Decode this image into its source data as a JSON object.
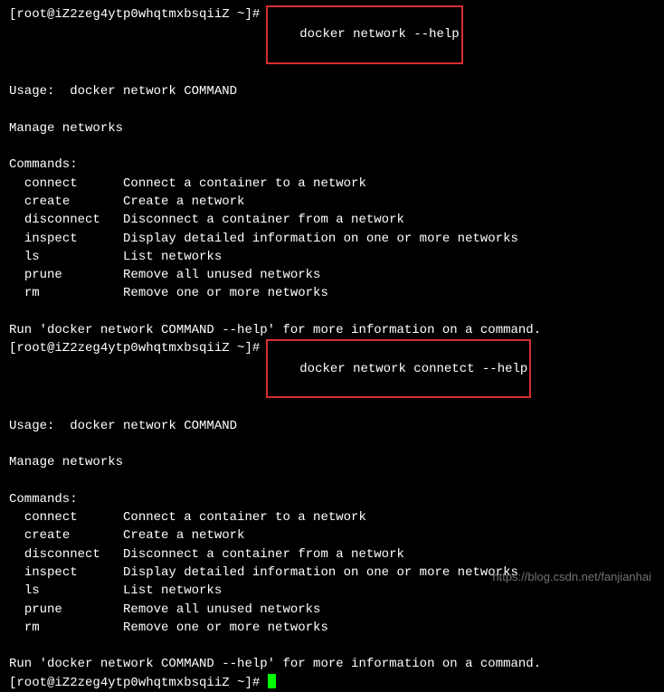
{
  "prompt": "[root@iZ2zeg4ytp0whqtmxbsqiiZ ~]# ",
  "cmd1": "docker network --help",
  "cmd2": "docker network connetct --help",
  "outputs": {
    "usage": "Usage:  docker network COMMAND",
    "manage": "Manage networks",
    "commands_header": "Commands:",
    "commands": [
      {
        "name": "connect",
        "desc": "Connect a container to a network"
      },
      {
        "name": "create",
        "desc": "Create a network"
      },
      {
        "name": "disconnect",
        "desc": "Disconnect a container from a network"
      },
      {
        "name": "inspect",
        "desc": "Display detailed information on one or more networks"
      },
      {
        "name": "ls",
        "desc": "List networks"
      },
      {
        "name": "prune",
        "desc": "Remove all unused networks"
      },
      {
        "name": "rm",
        "desc": "Remove one or more networks"
      }
    ],
    "hint": "Run 'docker network COMMAND --help' for more information on a command."
  },
  "watermark": "https://blog.csdn.net/fanjianhai"
}
